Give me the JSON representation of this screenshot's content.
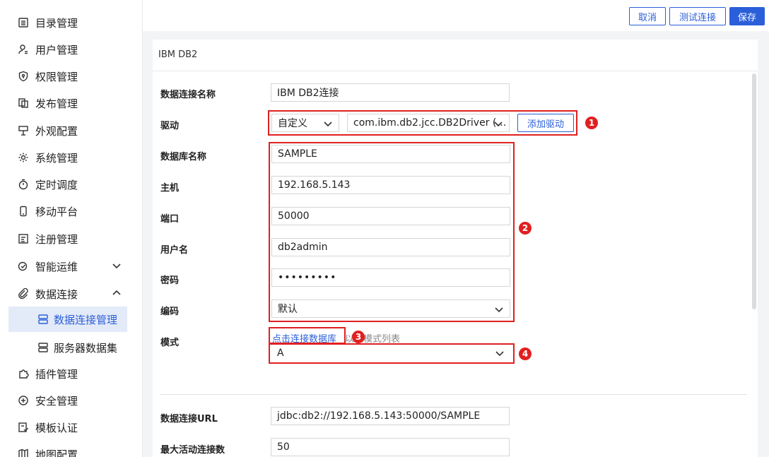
{
  "sidebar": {
    "items": [
      {
        "label": "目录管理",
        "icon": "list-icon"
      },
      {
        "label": "用户管理",
        "icon": "user-icon"
      },
      {
        "label": "权限管理",
        "icon": "shield-icon"
      },
      {
        "label": "发布管理",
        "icon": "copy-icon"
      },
      {
        "label": "外观配置",
        "icon": "layout-icon"
      },
      {
        "label": "系统管理",
        "icon": "gear-icon"
      },
      {
        "label": "定时调度",
        "icon": "timer-icon"
      },
      {
        "label": "移动平台",
        "icon": "mobile-icon"
      },
      {
        "label": "注册管理",
        "icon": "register-icon"
      },
      {
        "label": "智能运维",
        "icon": "ops-icon",
        "expanded": false
      },
      {
        "label": "数据连接",
        "icon": "link-icon",
        "expanded": true
      },
      {
        "label": "插件管理",
        "icon": "puzzle-icon"
      },
      {
        "label": "安全管理",
        "icon": "security-icon"
      },
      {
        "label": "模板认证",
        "icon": "template-icon"
      },
      {
        "label": "地图配置",
        "icon": "map-icon"
      }
    ],
    "sub_items": [
      {
        "label": "数据连接管理",
        "icon": "database-icon",
        "active": true
      },
      {
        "label": "服务器数据集",
        "icon": "database-icon",
        "active": false
      }
    ]
  },
  "toolbar": {
    "cancel_label": "取消",
    "test_label": "测试连接",
    "save_label": "保存"
  },
  "panel": {
    "title": "IBM DB2"
  },
  "form": {
    "conn_name_label": "数据连接名称",
    "conn_name_value": "IBM DB2连接",
    "driver_label": "驱动",
    "driver_type": "自定义",
    "driver_class": "com.ibm.db2.jcc.DB2Driver (…",
    "add_driver_label": "添加驱动",
    "db_name_label": "数据库名称",
    "db_name_value": "SAMPLE",
    "host_label": "主机",
    "host_value": "192.168.5.143",
    "port_label": "端口",
    "port_value": "50000",
    "username_label": "用户名",
    "username_value": "db2admin",
    "password_label": "密码",
    "password_value": "•••••••••",
    "encoding_label": "编码",
    "encoding_value": "默认",
    "schema_label": "模式",
    "schema_link": "点击连接数据库",
    "schema_hint": "以取模式列表",
    "schema_value": "A",
    "url_label": "数据连接URL",
    "url_value": "jdbc:db2://192.168.5.143:50000/SAMPLE",
    "max_active_label": "最大活动连接数",
    "max_active_value": "50"
  },
  "annotations": [
    "1",
    "2",
    "3",
    "4"
  ],
  "colors": {
    "accent": "#2b5fd9",
    "annotation_red": "#e02020",
    "active_bg": "#e3eaf8"
  }
}
